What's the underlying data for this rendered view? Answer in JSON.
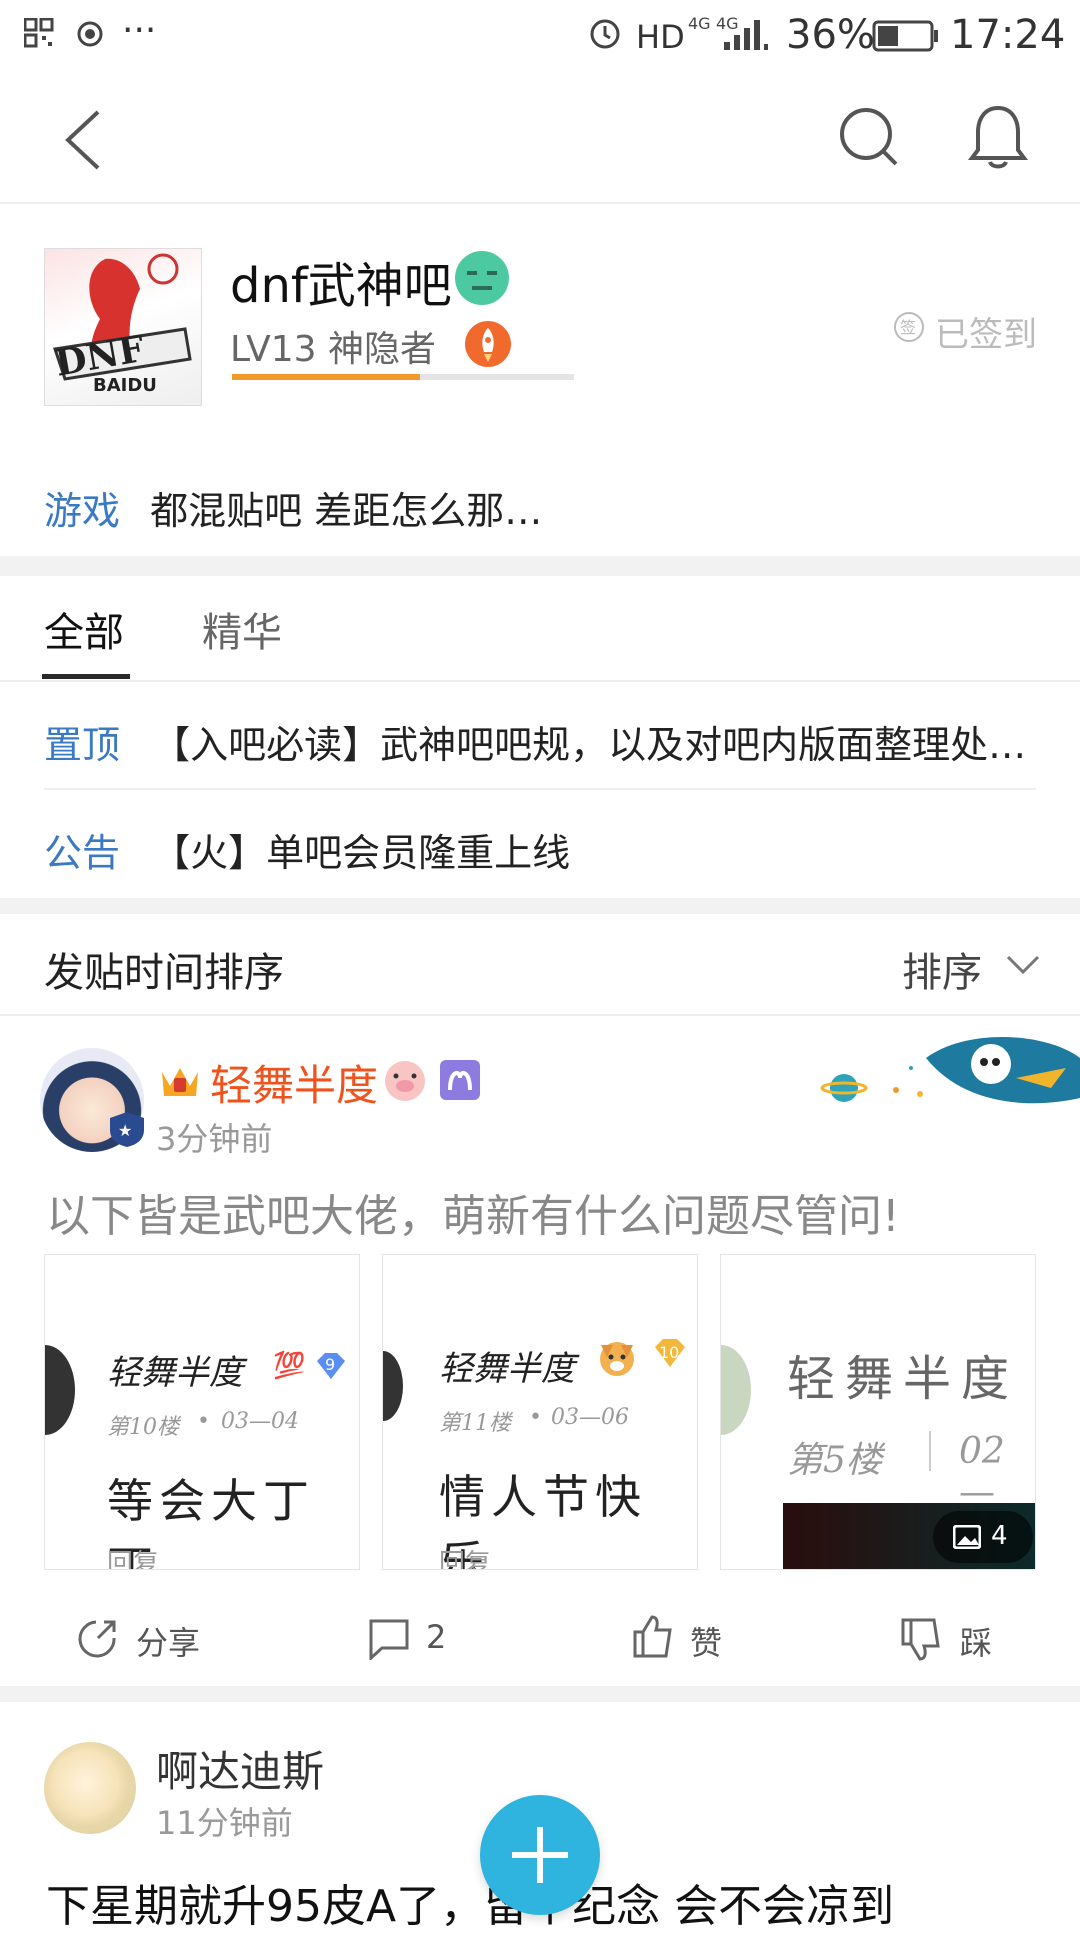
{
  "status_bar": {
    "network_hd": "HD",
    "network_4g_a": "4G",
    "network_4g_b": "4G",
    "battery": "36%",
    "time": "17:24",
    "more": "···"
  },
  "forum": {
    "name": "dnf武神吧",
    "level": "LV13 神隐者",
    "level_progress": 0.55,
    "signed": "已签到",
    "category": "游戏",
    "slogan": "都混贴吧 差距怎么那…"
  },
  "tabs": [
    {
      "label": "全部"
    },
    {
      "label": "精华"
    }
  ],
  "pinned": [
    {
      "tag": "置顶",
      "title": "【入吧必读】武神吧吧规，以及对吧内版面整理处…"
    },
    {
      "tag": "公告",
      "title": "【火】单吧会员隆重上线"
    }
  ],
  "sort": {
    "title": "发贴时间排序",
    "button": "排序"
  },
  "posts": [
    {
      "user": "轻舞半度",
      "time": "3分钟前",
      "text": "以下皆是武吧大佬，萌新有什么问题尽管问!",
      "thumbs": [
        {
          "name": "轻舞半度",
          "badge": "9",
          "floor": "第10楼",
          "date": "03—04",
          "content": "等会大丁丁",
          "reply": "回复"
        },
        {
          "name": "轻舞半度",
          "badge": "10",
          "floor": "第11楼",
          "date": "03—06",
          "content": "情人节快乐",
          "reply": "回复"
        },
        {
          "name": "轻舞半度",
          "floor": "第5楼",
          "date": "02—",
          "image_count": "4"
        }
      ],
      "actions": {
        "share": "分享",
        "comments": "2",
        "like": "赞",
        "dislike": "踩"
      }
    },
    {
      "user": "啊达迪斯",
      "time": "11分钟前",
      "text": "下星期就升95皮A了，留个纪念 会不会凉到"
    }
  ],
  "colors": {
    "accent_blue": "#3a79c4",
    "username_red": "#f0521e",
    "fab": "#2fb3df",
    "progress": "#f39a2c"
  }
}
